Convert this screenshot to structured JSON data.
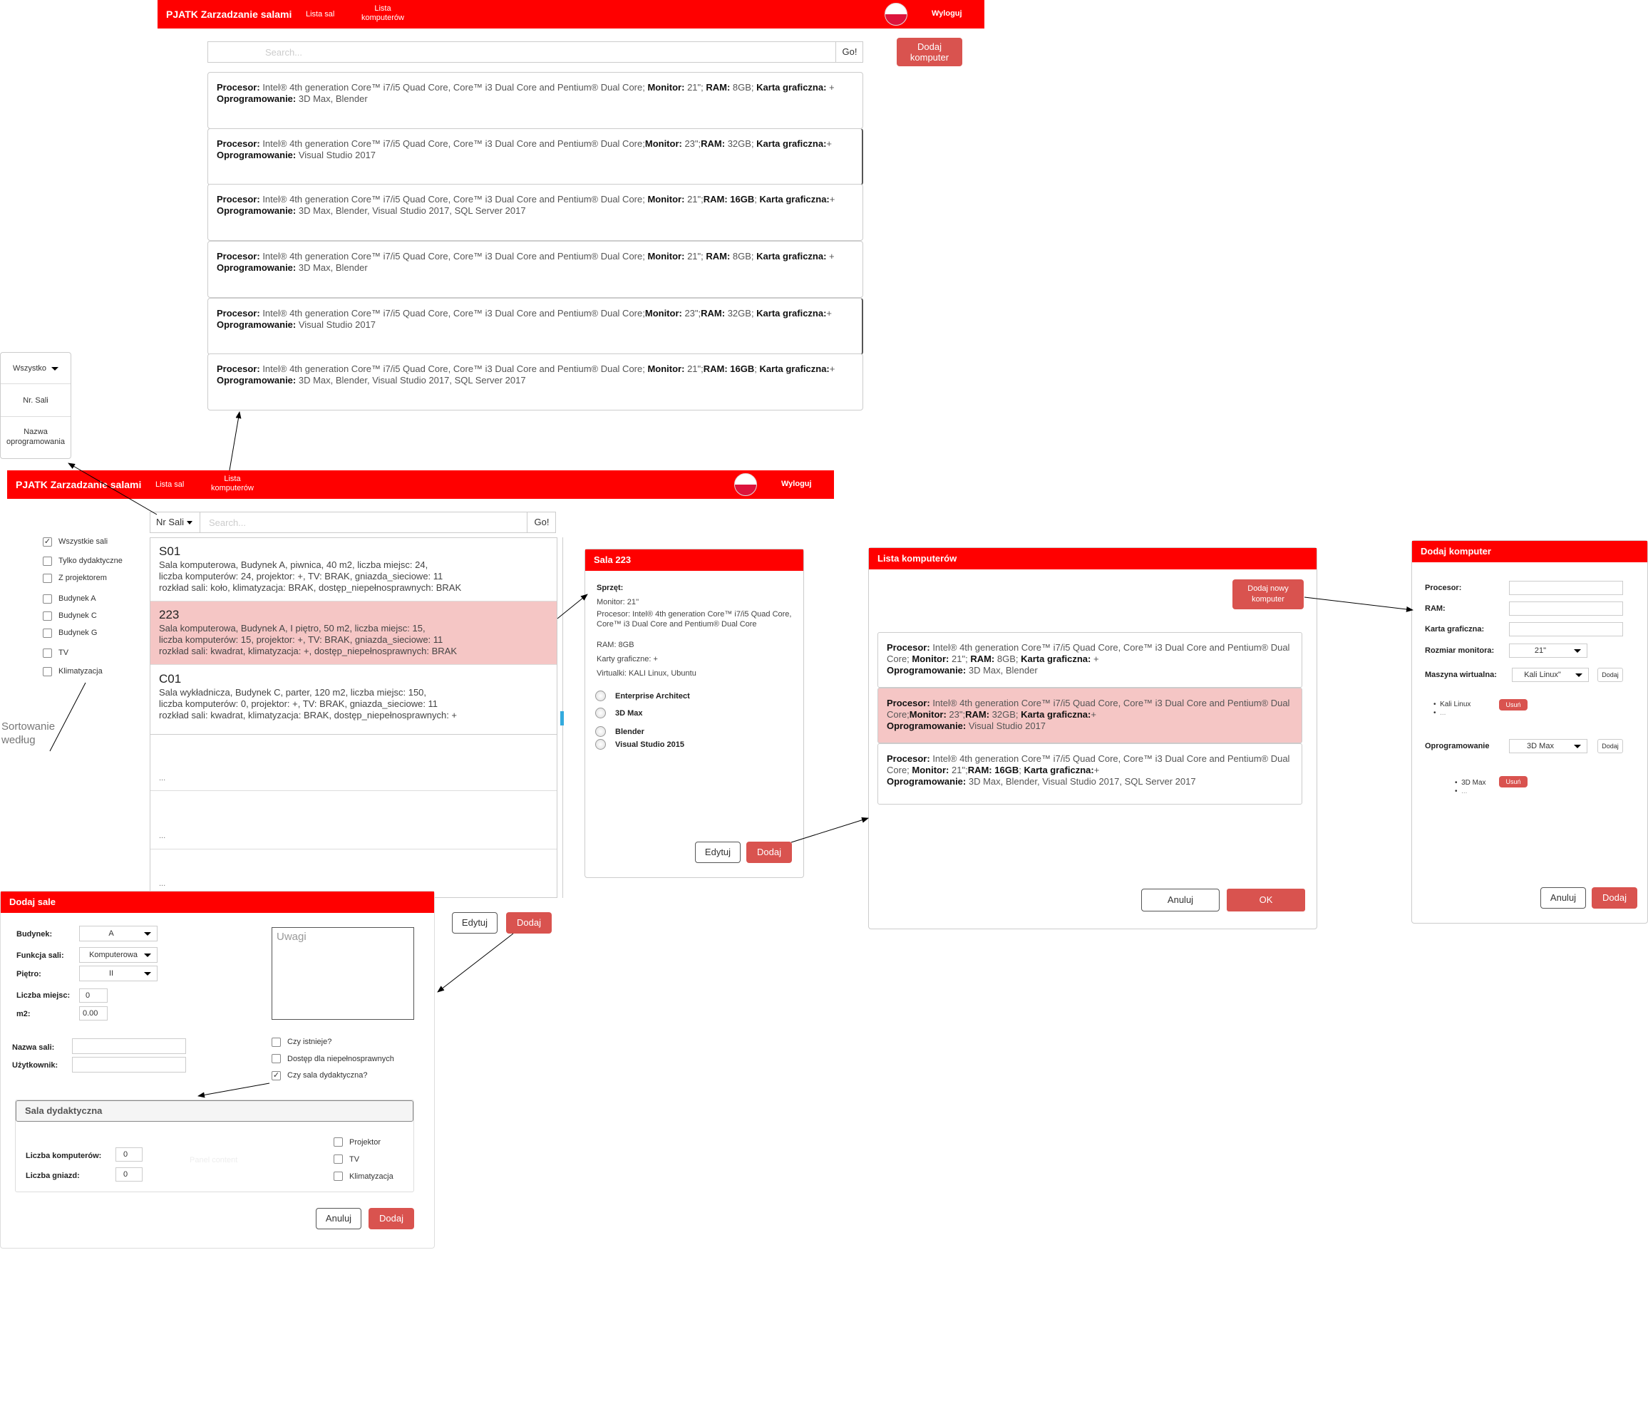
{
  "colors": {
    "brand": "#ff0000",
    "accent_button": "#d9534f",
    "selected_row": "#f5c6c5"
  },
  "top_nav": {
    "brand": "PJATK Zarzadzanie salami",
    "rooms_link": "Lista sal",
    "computers_link": "Lista komputerów",
    "logout": "Wyloguj"
  },
  "computers_page": {
    "search_placeholder": "Search...",
    "go": "Go!",
    "add_computer": "Dodaj komputer",
    "items": [
      {
        "proc_label": "Procesor:",
        "proc": " Intel® 4th generation Core™ i7/i5 Quad Core, Core™ i3 Dual Core and Pentium® Dual Core; ",
        "mon_label": "Monitor:",
        "mon": " 21\"; ",
        "ram_label": "RAM:",
        "ram": " 8GB; ",
        "gpu_label": "Karta graficzna:",
        "gpu": " +",
        "sw_label": "Oprogramowanie:",
        "sw": " 3D Max, Blender"
      },
      {
        "proc_label": "Procesor:",
        "proc": " Intel® 4th generation Core™ i7/i5 Quad Core, Core™ i3 Dual Core and Pentium® Dual Core;",
        "mon_label": "Monitor:",
        "mon": " 23\";",
        "ram_label": "RAM:",
        "ram": " 32GB; ",
        "gpu_label": "Karta graficzna:",
        "gpu": "+",
        "sw_label": "Oprogramowanie:",
        "sw": " Visual Studio 2017"
      },
      {
        "proc_label": "Procesor:",
        "proc": " Intel® 4th generation Core™ i7/i5 Quad Core, Core™ i3 Dual Core and Pentium® Dual Core; ",
        "mon_label": "Monitor:",
        "mon": " 21\";",
        "ram_label": "RAM: 16GB",
        "ram": "; ",
        "gpu_label": "Karta graficzna:",
        "gpu": "+",
        "sw_label": "Oprogramowanie:",
        "sw": " 3D Max, Blender, Visual Studio 2017, SQL Server 2017"
      },
      {
        "proc_label": "Procesor:",
        "proc": " Intel® 4th generation Core™ i7/i5 Quad Core, Core™ i3 Dual Core and Pentium® Dual Core; ",
        "mon_label": "Monitor:",
        "mon": " 21\"; ",
        "ram_label": "RAM:",
        "ram": " 8GB; ",
        "gpu_label": "Karta graficzna:",
        "gpu": " +",
        "sw_label": "Oprogramowanie:",
        "sw": " 3D Max, Blender"
      },
      {
        "proc_label": "Procesor:",
        "proc": " Intel® 4th generation Core™ i7/i5 Quad Core, Core™ i3 Dual Core and Pentium® Dual Core;",
        "mon_label": "Monitor:",
        "mon": " 23\";",
        "ram_label": "RAM:",
        "ram": " 32GB; ",
        "gpu_label": "Karta graficzna:",
        "gpu": "+",
        "sw_label": "Oprogramowanie:",
        "sw": " Visual Studio 2017"
      },
      {
        "proc_label": "Procesor:",
        "proc": " Intel® 4th generation Core™ i7/i5 Quad Core, Core™ i3 Dual Core and Pentium® Dual Core; ",
        "mon_label": "Monitor:",
        "mon": " 21\";",
        "ram_label": "RAM: 16GB",
        "ram": "; ",
        "gpu_label": "Karta graficzna:",
        "gpu": "+",
        "sw_label": "Oprogramowanie:",
        "sw": " 3D Max, Blender, Visual Studio 2017, SQL Server 2017"
      }
    ]
  },
  "sort_dropdown": {
    "options": [
      "Wszystko",
      "Nr. Sali",
      "Nazwa oprogramowania"
    ]
  },
  "sort_note": "Sortowanie według",
  "rooms_page": {
    "search_select": "Nr Sali",
    "search_placeholder": "Search...",
    "go": "Go!",
    "filters": [
      {
        "label": "Wszystkie sali",
        "checked": true
      },
      {
        "label": "Tylko dydaktyczne",
        "checked": false
      },
      {
        "label": "Z projektorem",
        "checked": false
      },
      {
        "label": "Budynek A",
        "checked": false
      },
      {
        "label": "Budynek C",
        "checked": false
      },
      {
        "label": "Budynek G",
        "checked": false
      },
      {
        "label": "TV",
        "checked": false
      },
      {
        "label": "Klimatyzacja",
        "checked": false
      }
    ],
    "rooms": [
      {
        "name": "S01",
        "l1": "Sala komputerowa, Budynek A, piwnica, 40 m2, liczba miejsc: 24,",
        "l2": "liczba komputerów: 24, projektor: +, TV: BRAK, gniazda_sieciowe: 11",
        "l3": "rozkład sali: koło, klimatyzacja: BRAK, dostęp_niepełnosprawnych: BRAK"
      },
      {
        "name": "223",
        "l1": "Sala komputerowa, Budynek A, I piętro, 50 m2, liczba miejsc: 15,",
        "l2": "liczba komputerów: 15, projektor: +, TV: BRAK, gniazda_sieciowe: 11",
        "l3": "rozkład sali: kwadrat, klimatyzacja: +, dostęp_niepełnosprawnych: BRAK"
      },
      {
        "name": "C01",
        "l1": "Sala wykładnicza, Budynek C, parter, 120 m2, liczba miejsc: 150,",
        "l2": "liczba komputerów: 0, projektor: +, TV: BRAK, gniazda_sieciowe: 11",
        "l3": "rozkład sali: kwadrat, klimatyzacja: BRAK, dostęp_niepełnosprawnych: +"
      }
    ],
    "ellipsis": "...",
    "edit": "Edytuj",
    "add": "Dodaj"
  },
  "room_detail": {
    "title": "Sala 223",
    "equipment_label": "Sprzęt:",
    "monitor": "Monitor: 21''",
    "processor": "Procesor: Intel® 4th generation Core™ i7/i5 Quad Core, Core™ i3 Dual Core and Pentium® Dual Core",
    "ram": "RAM: 8GB",
    "gpu": "Karty graficzne: +",
    "virtual": "Virtualki: KALI Linux, Ubuntu",
    "software": [
      "Enterprise Architect",
      "3D Max",
      "Blender",
      "Visual Studio 2015"
    ],
    "edit": "Edytuj",
    "add": "Dodaj"
  },
  "computer_list_modal": {
    "title": "Lista komputerów",
    "add_new": "Dodaj nowy komputer",
    "items": [
      {
        "proc_label": "Procesor:",
        "proc": " Intel® 4th generation Core™ i7/i5 Quad Core, Core™ i3 Dual Core and Pentium® Dual Core; ",
        "mon_label": "Monitor:",
        "mon": " 21\"; ",
        "ram_label": "RAM:",
        "ram": " 8GB; ",
        "gpu_label": "Karta graficzna:",
        "gpu": " +",
        "sw_label": "Oprogramowanie:",
        "sw": " 3D Max, Blender"
      },
      {
        "proc_label": "Procesor:",
        "proc": " Intel® 4th generation Core™ i7/i5 Quad Core, Core™ i3 Dual Core and Pentium® Dual Core;",
        "mon_label": "Monitor:",
        "mon": " 23\";",
        "ram_label": "RAM:",
        "ram": " 32GB; ",
        "gpu_label": "Karta graficzna:",
        "gpu": "+",
        "sw_label": "Oprogramowanie:",
        "sw": " Visual Studio 2017"
      },
      {
        "proc_label": "Procesor:",
        "proc": " Intel® 4th generation Core™ i7/i5 Quad Core, Core™ i3 Dual Core and Pentium® Dual Core; ",
        "mon_label": "Monitor:",
        "mon": " 21\";",
        "ram_label": "RAM: 16GB",
        "ram": "; ",
        "gpu_label": "Karta graficzna:",
        "gpu": "+",
        "sw_label": "Oprogramowanie:",
        "sw": " 3D Max, Blender, Visual Studio 2017, SQL Server 2017"
      }
    ],
    "cancel": "Anuluj",
    "ok": "OK"
  },
  "add_computer_form": {
    "title": "Dodaj komputer",
    "processor": "Procesor:",
    "ram": "RAM:",
    "gpu": "Karta graficzna:",
    "monitor_size": "Rozmiar monitora:",
    "monitor_value": "21\"",
    "vm": "Maszyna wirtualna:",
    "vm_value": "Kali Linux\"",
    "add_small": "Dodaj",
    "vm_items": [
      "Kali Linux",
      "..."
    ],
    "remove": "Usuń",
    "software": "Oprogramowanie",
    "software_value": "3D Max",
    "sw_items": [
      "3D Max",
      "..."
    ],
    "cancel": "Anuluj",
    "add": "Dodaj"
  },
  "add_room_form": {
    "title": "Dodaj sale",
    "building": "Budynek:",
    "building_value": "A",
    "function": "Funkcja sali:",
    "function_value": "Komputerowa",
    "floor": "Piętro:",
    "floor_value": "II",
    "seats": "Liczba miejsc:",
    "seats_value": "0",
    "area": "m2:",
    "area_value": "0.00",
    "notes_placeholder": "Uwagi",
    "room_name": "Nazwa sali:",
    "user": "Użytkownik:",
    "exists": "Czy istnieje?",
    "accessible": "Dostęp dla niepełnosprawnych",
    "didactic": "Czy sala dydaktyczna?",
    "didactic_section": "Sala dydaktyczna",
    "computers": "Liczba komputerów:",
    "computers_value": "0",
    "sockets": "Liczba gniazd:",
    "sockets_value": "0",
    "panel_content": "Panel content",
    "projector": "Projektor",
    "tv": "TV",
    "ac": "Klimatyzacja",
    "cancel": "Anuluj",
    "add": "Dodaj"
  }
}
